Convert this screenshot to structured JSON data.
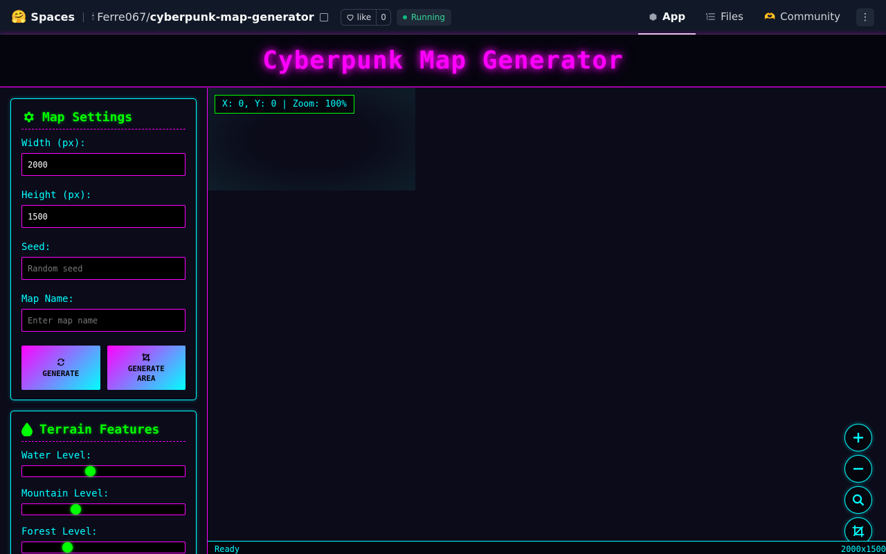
{
  "hf": {
    "logo_emoji": "🤗",
    "spaces_label": "Spaces",
    "owner_avatar": "🕯",
    "owner": "Ferre067",
    "slash": "/",
    "repo": "cyberpunk-map-generator",
    "like_label": "like",
    "like_count": "0",
    "status": "Running",
    "tabs": [
      {
        "label": "App",
        "icon": "app-icon"
      },
      {
        "label": "Files",
        "icon": "files-icon"
      },
      {
        "label": "Community",
        "icon": "community-icon"
      }
    ],
    "more_icon": "⋮",
    "community_emoji": "🫶"
  },
  "app": {
    "title": "Cyberpunk Map Generator"
  },
  "map_settings": {
    "title": "Map Settings",
    "icon": "gear-icon",
    "width_label": "Width (px):",
    "width_value": "2000",
    "height_label": "Height (px):",
    "height_value": "1500",
    "seed_label": "Seed:",
    "seed_placeholder": "Random seed",
    "name_label": "Map Name:",
    "name_placeholder": "Enter map name",
    "generate_label": "GENERATE",
    "generate_area_line1": "GENERATE",
    "generate_area_line2": "AREA"
  },
  "terrain": {
    "title": "Terrain Features",
    "icon": "droplet-icon",
    "water_label": "Water Level:",
    "water_value": 0.42,
    "mountain_label": "Mountain Level:",
    "mountain_value": 0.33,
    "forest_label": "Forest Level:",
    "forest_value": 0.28
  },
  "canvas": {
    "coords": "X: 0, Y: 0 | Zoom: 100%",
    "status_left": "Ready",
    "status_right": "2000x1500"
  },
  "colors": {
    "neon_pink": "#ff00ff",
    "neon_cyan": "#00ffff",
    "neon_green": "#00ff00",
    "background": "#0b0b1a"
  }
}
